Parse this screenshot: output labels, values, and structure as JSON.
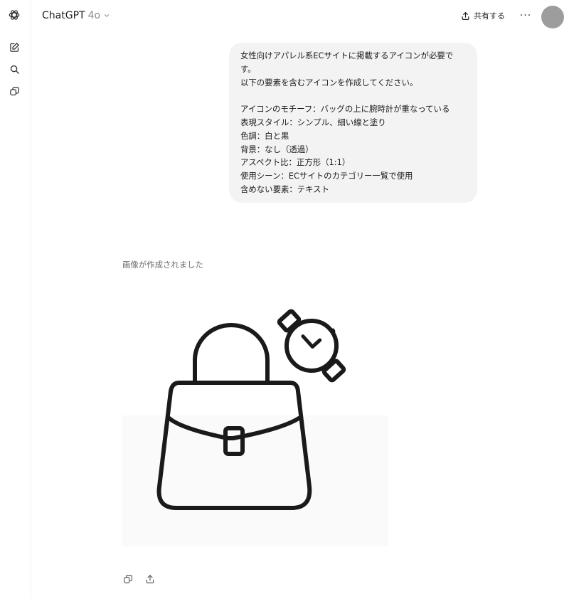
{
  "header": {
    "model_name": "ChatGPT",
    "model_version": "4o",
    "share_label": "共有する",
    "more_label": "···"
  },
  "sidebar": {
    "icons": [
      "openai-logo-icon",
      "new-chat-icon",
      "search-icon",
      "gpts-icon"
    ]
  },
  "conversation": {
    "user_message": "女性向けアパレル系ECサイトに掲載するアイコンが必要です。\n以下の要素を含むアイコンを作成してください。\n\nアイコンのモチーフ：バッグの上に腕時計が重なっている\n表現スタイル：シンプル、細い線と塗り\n色調：白と黒\n背景：なし（透過）\nアスペクト比：正方形（1:1）\n使用シーン：ECサイトのカテゴリー一覧で使用\n含めない要素：テキスト",
    "assistant_status": "画像が作成されました",
    "generated_image_icons": [
      "handbag-icon",
      "wristwatch-icon"
    ]
  },
  "actions": {
    "icons": [
      "copy-icon",
      "share-icon"
    ]
  },
  "colors": {
    "bubble": "#f3f3f3",
    "avatar": "#9d9d9d",
    "icon_stroke": "#1a1a1a"
  }
}
